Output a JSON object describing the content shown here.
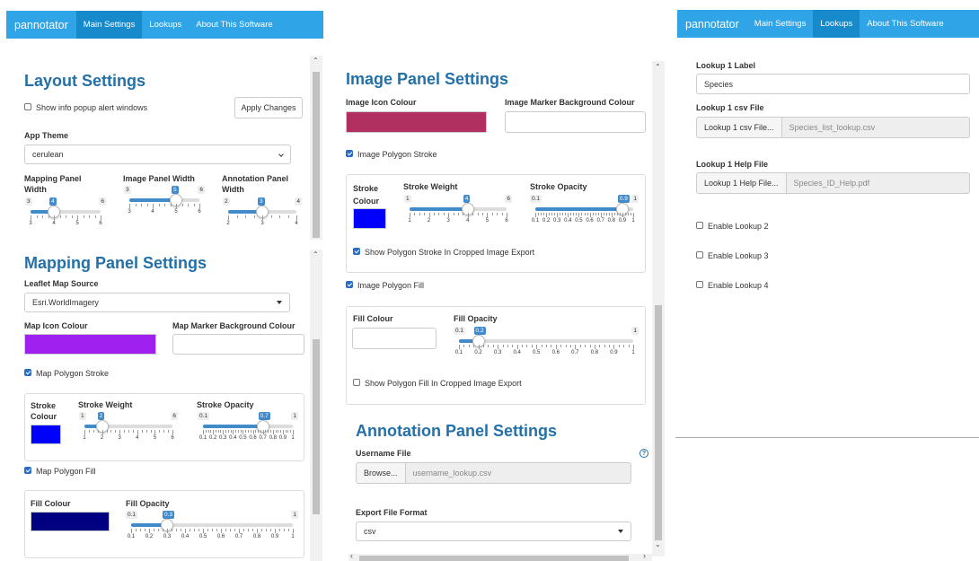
{
  "left": {
    "nav": {
      "brand": "pannotator",
      "tabs": [
        "Main Settings",
        "Lookups",
        "About This Software"
      ]
    },
    "layout": {
      "title": "Layout Settings",
      "popup_label": "Show info popup alert windows",
      "apply_label": "Apply Changes",
      "theme_label": "App Theme",
      "theme_value": "cerulean",
      "sliders": [
        {
          "label": "Mapping Panel Width",
          "min": 3,
          "max": 6,
          "value": 4,
          "ticks": [
            3,
            4,
            5,
            6
          ]
        },
        {
          "label": "Image Panel Width",
          "min": 3,
          "max": 6,
          "value": 5,
          "ticks": [
            3,
            4,
            5,
            6
          ]
        },
        {
          "label": "Annotation Panel Width",
          "min": 2,
          "max": 4,
          "value": 3,
          "ticks": [
            2,
            3,
            4
          ]
        }
      ]
    },
    "mapping": {
      "title": "Mapping Panel Settings",
      "source_label": "Leaflet Map Source",
      "source_value": "Esri.WorldImagery",
      "icon_colour_label": "Map Icon Colour",
      "icon_colour": "#A020F0",
      "marker_bg_label": "Map Marker Background Colour",
      "stroke_cb": "Map Polygon Stroke",
      "stroke_colour_label": "Stroke Colour",
      "stroke_colour": "#0000FF",
      "stroke_weight": {
        "label": "Stroke Weight",
        "min": 1,
        "max": 6,
        "value": 2,
        "ticks": [
          1,
          2,
          3,
          4,
          5,
          6
        ]
      },
      "stroke_opacity": {
        "label": "Stroke Opacity",
        "min": 0.1,
        "max": 1,
        "value": 0.7,
        "ticks": [
          "0.1",
          "0.2",
          "0.3",
          "0.4",
          "0.5",
          "0.6",
          "0.7",
          "0.8",
          "0.9",
          "1"
        ]
      },
      "fill_cb": "Map Polygon Fill",
      "fill_colour_label": "Fill Colour",
      "fill_colour": "#000080",
      "fill_opacity": {
        "label": "Fill Opacity",
        "min": 0.1,
        "max": 1,
        "value": 0.3,
        "ticks": [
          "0.1",
          "0.2",
          "0.3",
          "0.4",
          "0.5",
          "0.6",
          "0.7",
          "0.8",
          "0.9",
          "1"
        ]
      }
    }
  },
  "middle": {
    "image": {
      "title": "Image Panel Settings",
      "icon_colour_label": "Image Icon Colour",
      "icon_colour": "#B03060",
      "marker_bg_label": "Image Marker Background Colour",
      "stroke_cb": "Image Polygon Stroke",
      "stroke_colour_label": "Stroke Colour",
      "stroke_colour": "#0000FF",
      "stroke_weight": {
        "label": "Stroke Weight",
        "min": 1,
        "max": 6,
        "value": 4,
        "ticks": [
          1,
          2,
          3,
          4,
          5,
          6
        ]
      },
      "stroke_opacity": {
        "label": "Stroke Opacity",
        "min": 0.1,
        "max": 1,
        "value": 0.9,
        "ticks": [
          "0.1",
          "0.2",
          "0.3",
          "0.4",
          "0.5",
          "0.6",
          "0.7",
          "0.8",
          "0.9",
          "1"
        ]
      },
      "show_stroke_label": "Show Polygon Stroke In Cropped Image Export",
      "fill_cb": "Image Polygon Fill",
      "fill_colour_label": "Fill Colour",
      "fill_opacity": {
        "label": "Fill Opacity",
        "min": 0.1,
        "max": 1,
        "value": 0.2,
        "ticks": [
          "0.1",
          "0.2",
          "0.3",
          "0.4",
          "0.5",
          "0.6",
          "0.7",
          "0.8",
          "0.9",
          "1"
        ]
      },
      "show_fill_label": "Show Polygon Fill In Cropped Image Export"
    },
    "annotation": {
      "title": "Annotation Panel Settings",
      "username_label": "Username File",
      "browse_label": "Browse...",
      "username_value": "username_lookup.csv",
      "help_glyph": "?",
      "export_label": "Export File Format",
      "export_value": "csv"
    }
  },
  "right": {
    "nav": {
      "brand": "pannotator",
      "tabs": [
        "Main Settings",
        "Lookups",
        "About This Software"
      ]
    },
    "lookup1_label_title": "Lookup 1 Label",
    "lookup1_label_value": "Species",
    "lookup1_csv_title": "Lookup 1 csv File",
    "lookup1_csv_button": "Lookup 1 csv File...",
    "lookup1_csv_value": "Species_list_lookup.csv",
    "lookup1_help_title": "Lookup 1 Help File",
    "lookup1_help_button": "Lookup 1 Help File...",
    "lookup1_help_value": "Species_ID_Help.pdf",
    "enable2": "Enable Lookup 2",
    "enable3": "Enable Lookup 3",
    "enable4": "Enable Lookup 4"
  },
  "scroll_glyphs": {
    "up": "⌃",
    "down": "⌄",
    "left": "‹",
    "right": "›"
  }
}
